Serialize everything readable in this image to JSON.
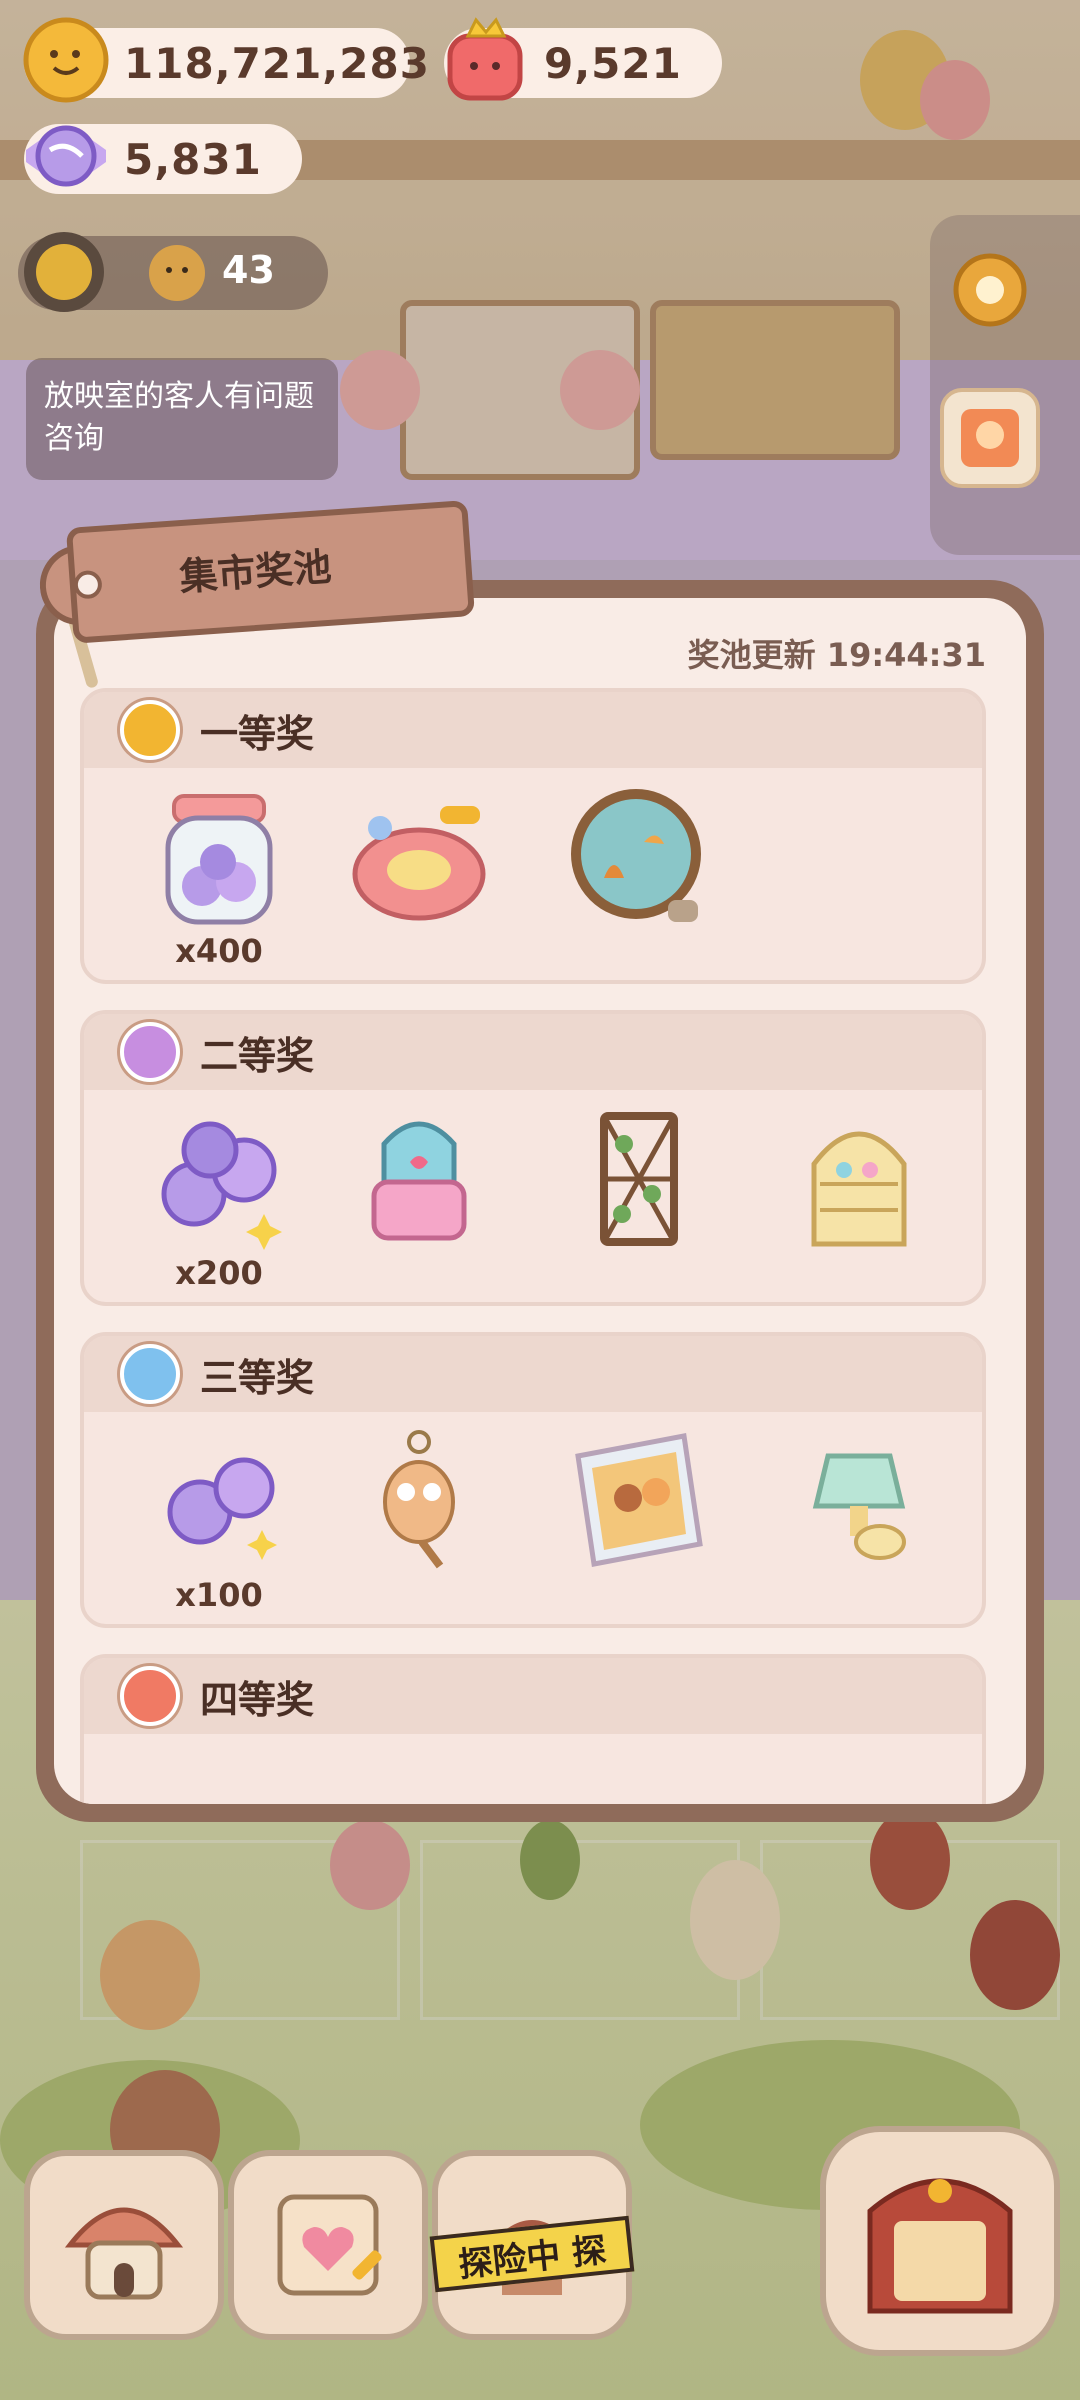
{
  "hud": {
    "coins": "118,721,283",
    "gems": "9,521",
    "candies": "5,831",
    "level_count": "43"
  },
  "notice": "放映室的客人有问题咨询",
  "modal": {
    "title": "集市奖池",
    "refresh_text": "奖池更新 19:44:31",
    "tiers": [
      {
        "title": "一等奖",
        "color": "#f2b531",
        "items": [
          {
            "name": "candy-jar",
            "qty": "x400"
          },
          {
            "name": "flamingo-float",
            "qty": ""
          },
          {
            "name": "round-aquarium",
            "qty": ""
          }
        ]
      },
      {
        "title": "二等奖",
        "color": "#c78ee0",
        "items": [
          {
            "name": "candies",
            "qty": "x200"
          },
          {
            "name": "pink-backpack",
            "qty": ""
          },
          {
            "name": "ivy-trellis",
            "qty": ""
          },
          {
            "name": "arched-shelf",
            "qty": ""
          }
        ]
      },
      {
        "title": "三等奖",
        "color": "#7fc1ee",
        "items": [
          {
            "name": "candies",
            "qty": "x100"
          },
          {
            "name": "owl-keychain",
            "qty": ""
          },
          {
            "name": "photo-frame",
            "qty": ""
          },
          {
            "name": "wall-lamp",
            "qty": ""
          }
        ]
      },
      {
        "title": "四等奖",
        "color": "#f07a64",
        "items": []
      }
    ]
  },
  "dock": {
    "explore_label": "探险中 探"
  }
}
